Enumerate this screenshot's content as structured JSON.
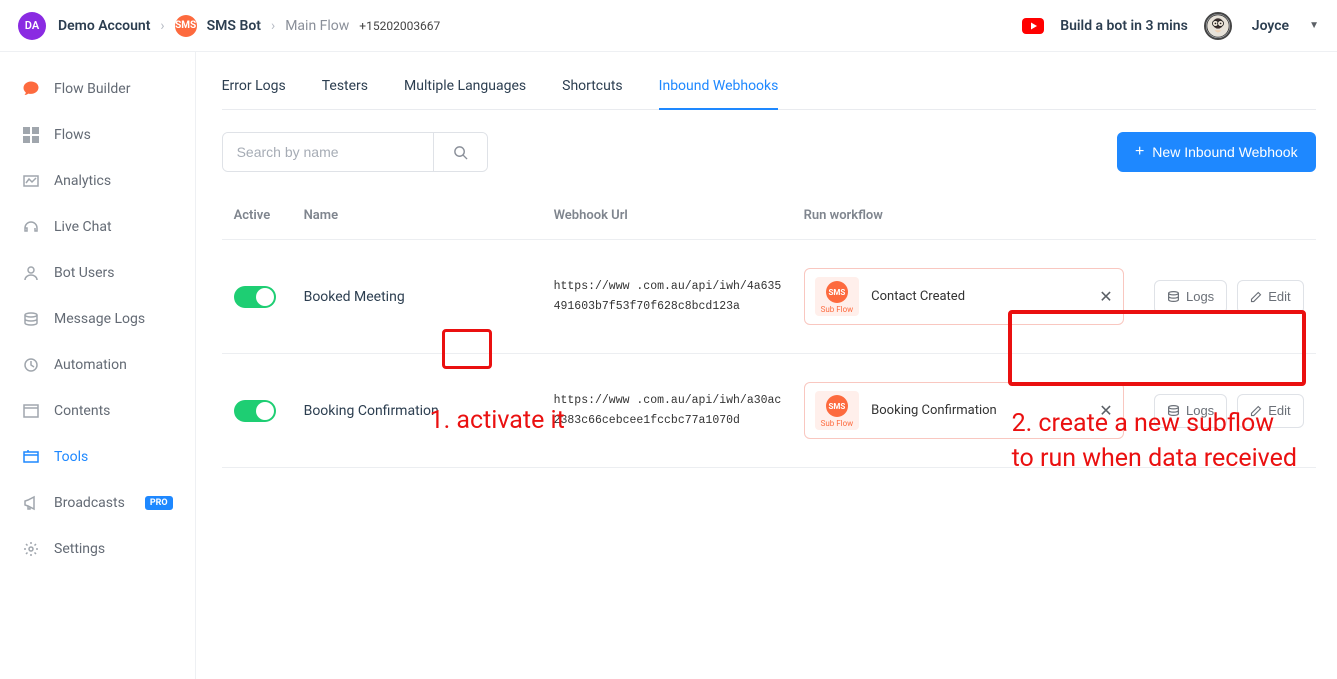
{
  "header": {
    "account_initials": "DA",
    "account_name": "Demo Account",
    "bot_name": "SMS Bot",
    "flow_name": "Main Flow",
    "phone": "+15202003667",
    "build_bot_label": "Build a bot in 3 mins",
    "user_name": "Joyce"
  },
  "sidebar": {
    "items": [
      {
        "label": "Flow Builder"
      },
      {
        "label": "Flows"
      },
      {
        "label": "Analytics"
      },
      {
        "label": "Live Chat"
      },
      {
        "label": "Bot Users"
      },
      {
        "label": "Message Logs"
      },
      {
        "label": "Automation"
      },
      {
        "label": "Contents"
      },
      {
        "label": "Tools"
      },
      {
        "label": "Broadcasts"
      },
      {
        "label": "Settings"
      }
    ],
    "pro_badge": "PRO"
  },
  "tabs": {
    "error_logs": "Error Logs",
    "testers": "Testers",
    "languages": "Multiple Languages",
    "shortcuts": "Shortcuts",
    "inbound": "Inbound Webhooks"
  },
  "search": {
    "placeholder": "Search by name"
  },
  "new_btn": "New Inbound Webhook",
  "table": {
    "headers": {
      "active": "Active",
      "name": "Name",
      "url": "Webhook Url",
      "workflow": "Run workflow"
    },
    "rows": [
      {
        "name": "Booked Meeting",
        "url": "https://www        .com.au/api/iwh/4a635491603b7f53f70f628c8bcd123a",
        "workflow": {
          "name": "Contact Created",
          "sub": "Sub Flow"
        }
      },
      {
        "name": "Booking Confirmation",
        "url": "https://www        .com.au/api/iwh/a30ac2383c66cebcee1fccbc77a1070d",
        "workflow": {
          "name": "Booking Confirmation",
          "sub": "Sub Flow"
        }
      }
    ]
  },
  "actions": {
    "logs": "Logs",
    "edit": "Edit"
  },
  "annotations": {
    "one": "1. activate it",
    "two": "2. create a new subflow\nto run when data received"
  }
}
